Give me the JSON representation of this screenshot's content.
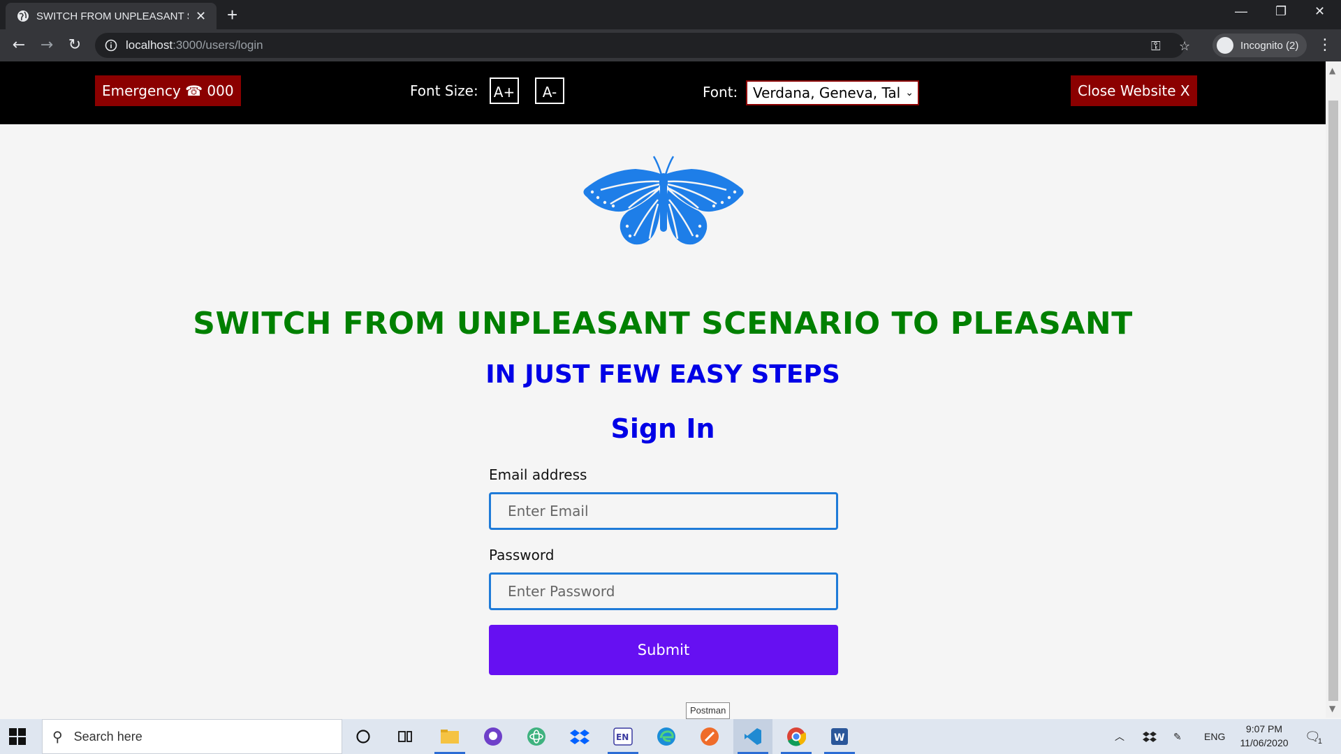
{
  "browser": {
    "tab_title": "SWITCH FROM UNPLEASANT SC",
    "new_tab": "+",
    "url_host": "localhost",
    "url_path": ":3000/users/login",
    "incognito_label": "Incognito (2)"
  },
  "topbar": {
    "emergency_label": "Emergency ☎ 000",
    "font_size_label": "Font Size:",
    "increase_label": "A+",
    "decrease_label": "A-",
    "font_label": "Font:",
    "font_selected": "Verdana, Geneva, Tal",
    "close_label": "Close Website X"
  },
  "main": {
    "headline": "SWITCH FROM UNPLEASANT SCENARIO TO PLEASANT",
    "subheadline": "IN JUST FEW EASY STEPS",
    "form_title": "Sign In",
    "email_label": "Email address",
    "email_placeholder": "Enter Email",
    "password_label": "Password",
    "password_placeholder": "Enter Password",
    "submit_label": "Submit",
    "logo_color": "#1e7ee8"
  },
  "tooltip": "Postman",
  "taskbar": {
    "search_placeholder": "Search here",
    "apps": [
      "file-explorer",
      "github-desktop",
      "atom",
      "dropbox",
      "language-en",
      "edge",
      "postman",
      "vscode",
      "chrome",
      "word"
    ],
    "lang": "ENG",
    "time": "9:07 PM",
    "date": "11/06/2020",
    "notification_count": "1"
  },
  "colors": {
    "headline": "#008000",
    "sub": "#0000e6",
    "button": "#6610f2",
    "danger": "#8b0000"
  }
}
